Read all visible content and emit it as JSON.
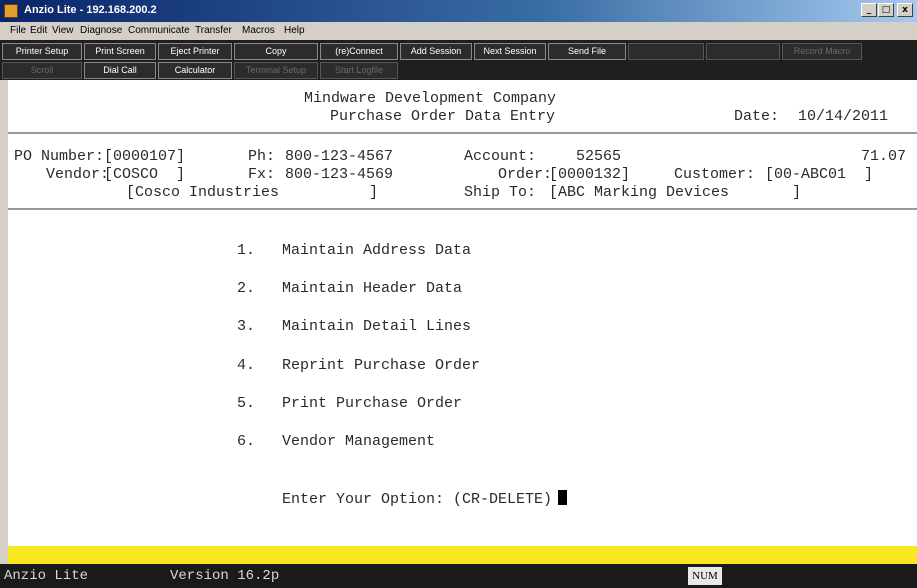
{
  "window": {
    "title": "Anzio Lite - 192.168.200.2",
    "minimize_glyph": "_",
    "maximize_glyph": "□",
    "close_glyph": "x"
  },
  "menu": [
    "File",
    "Edit",
    "View",
    "Diagnose",
    "Communicate",
    "Transfer",
    "Macros",
    "Help"
  ],
  "toolbar": {
    "row1": [
      {
        "label": "Printer Setup",
        "enabled": true
      },
      {
        "label": "Print Screen",
        "enabled": true
      },
      {
        "label": "Eject Printer",
        "enabled": true
      },
      {
        "label": "Copy",
        "enabled": true
      },
      {
        "label": "(re)Connect",
        "enabled": true
      },
      {
        "label": "Add Session",
        "enabled": true
      },
      {
        "label": "Next Session",
        "enabled": true
      },
      {
        "label": "Send File",
        "enabled": true
      },
      {
        "label": "",
        "enabled": false
      },
      {
        "label": "",
        "enabled": false
      },
      {
        "label": "Record Macro",
        "enabled": false
      }
    ],
    "row2": [
      {
        "label": "Scroll",
        "enabled": false
      },
      {
        "label": "Dial Call",
        "enabled": true
      },
      {
        "label": "Calculator",
        "enabled": true
      },
      {
        "label": "Terminal Setup",
        "enabled": false
      },
      {
        "label": "Start Logfile",
        "enabled": false
      }
    ]
  },
  "screen": {
    "company": "Mindware Development Company",
    "subtitle": "Purchase Order Data Entry",
    "date_label": "Date:",
    "date": "10/14/2011",
    "header": {
      "po_number_label": "PO Number:",
      "po_number": "[0000107]",
      "phone_label": "Ph:",
      "phone": "800-123-4567",
      "account_label": "Account:",
      "account": "52565",
      "amount": "71.07",
      "vendor_label": "Vendor:",
      "vendor": "[COSCO  ]",
      "fax_label": "Fx:",
      "fax": "800-123-4569",
      "order_label": "Order:",
      "order": "[0000132]",
      "customer_label": "Customer:",
      "customer": "[00-ABC01  ]",
      "vendor_name": "[Cosco Industries          ]",
      "ship_to_label": "Ship To:",
      "ship_to": "[ABC Marking Devices       ]"
    },
    "options": [
      {
        "num": "1.",
        "label": "Maintain Address Data"
      },
      {
        "num": "2.",
        "label": "Maintain Header Data"
      },
      {
        "num": "3.",
        "label": "Maintain Detail Lines"
      },
      {
        "num": "4.",
        "label": "Reprint Purchase Order"
      },
      {
        "num": "5.",
        "label": "Print Purchase Order"
      },
      {
        "num": "6.",
        "label": "Vendor Management"
      }
    ],
    "prompt": "Enter Your Option: (CR-DELETE)"
  },
  "status": {
    "product": "Anzio Lite",
    "version": "Version 16.2p",
    "num_indicator": "NUM"
  }
}
